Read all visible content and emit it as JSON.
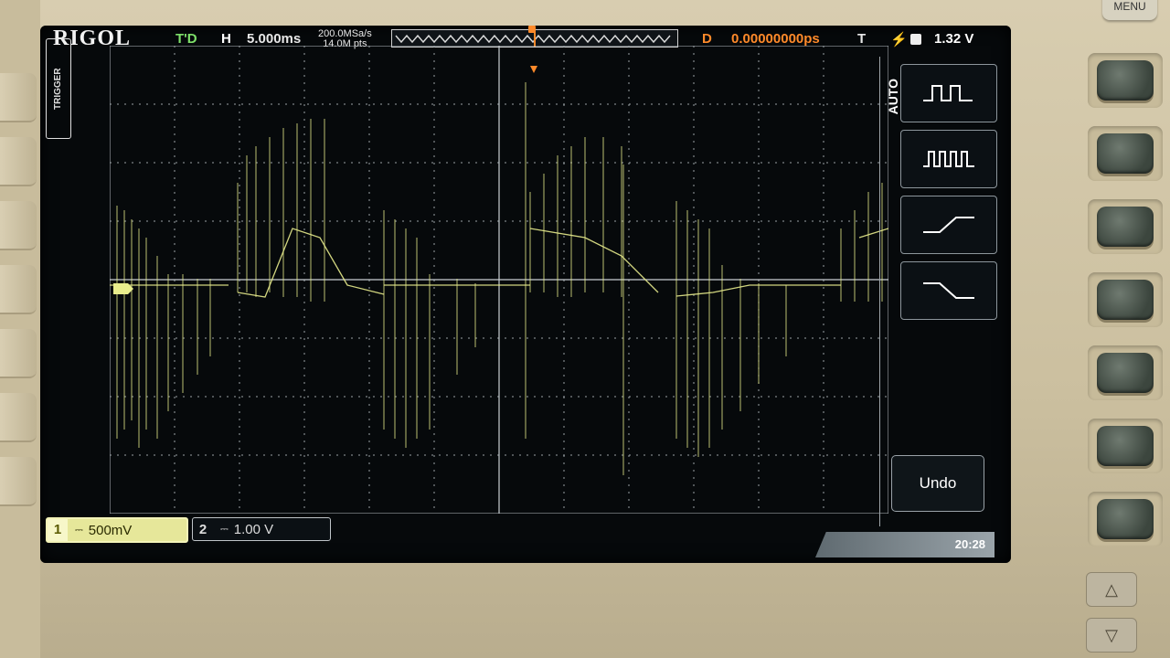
{
  "header": {
    "brand": "RIGOL",
    "trigger_status": "T'D",
    "horizontal_label": "H",
    "timebase": "5.000ms",
    "sample_rate": "200.0MSa/s",
    "memory_depth": "14.0M pts",
    "delay_label": "D",
    "delay_value": "0.00000000ps",
    "trigger_label": "T",
    "trigger_level": "1.32 V"
  },
  "side_tab": {
    "label": "TRIGGER"
  },
  "menu": {
    "title": "AUTO",
    "softkeys": [
      {
        "icon": "single-pulse-icon"
      },
      {
        "icon": "multi-pulse-icon"
      },
      {
        "icon": "rising-edge-icon"
      },
      {
        "icon": "falling-edge-icon"
      }
    ],
    "undo_label": "Undo"
  },
  "channels": [
    {
      "number": "1",
      "scale": "500mV",
      "color": "#e6e79a"
    },
    {
      "number": "2",
      "scale": "1.00 V",
      "color": "#bfc4c8"
    }
  ],
  "clock": "20:28",
  "panel": {
    "menu_button_label": "MENU"
  },
  "colors": {
    "trace": "#e8ec8c",
    "grid": "#b9bfc4",
    "screen_bg": "#06090b",
    "trigger_marker": "#ff8a2a"
  }
}
